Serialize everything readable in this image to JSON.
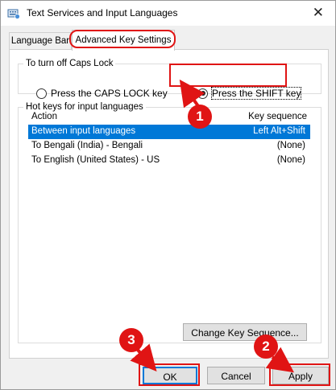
{
  "window": {
    "title": "Text Services and Input Languages",
    "close_glyph": "✕",
    "icon": "keyboard-language-icon"
  },
  "tabs": [
    {
      "label": "Language Bar",
      "active": false
    },
    {
      "label": "Advanced Key Settings",
      "active": true
    }
  ],
  "caps_lock": {
    "group_label": "To turn off Caps Lock",
    "options": [
      {
        "label": "Press the CAPS LOCK key",
        "checked": false
      },
      {
        "label": "Press the SHIFT key",
        "checked": true
      }
    ]
  },
  "hotkeys": {
    "group_label": "Hot keys for input languages",
    "columns": [
      "Action",
      "Key sequence"
    ],
    "rows": [
      {
        "action": "Between input languages",
        "key": "Left Alt+Shift",
        "selected": true
      },
      {
        "action": "To Bengali (India) - Bengali",
        "key": "(None)",
        "selected": false
      },
      {
        "action": "To English (United States) - US",
        "key": "(None)",
        "selected": false
      }
    ],
    "change_button": "Change Key Sequence..."
  },
  "buttons": {
    "ok": "OK",
    "cancel": "Cancel",
    "apply": "Apply"
  },
  "annotations": {
    "badges": [
      "1",
      "2",
      "3"
    ],
    "highlight_color": "#e01414"
  },
  "colors": {
    "selection": "#0078d7",
    "highlight": "#e01414"
  }
}
